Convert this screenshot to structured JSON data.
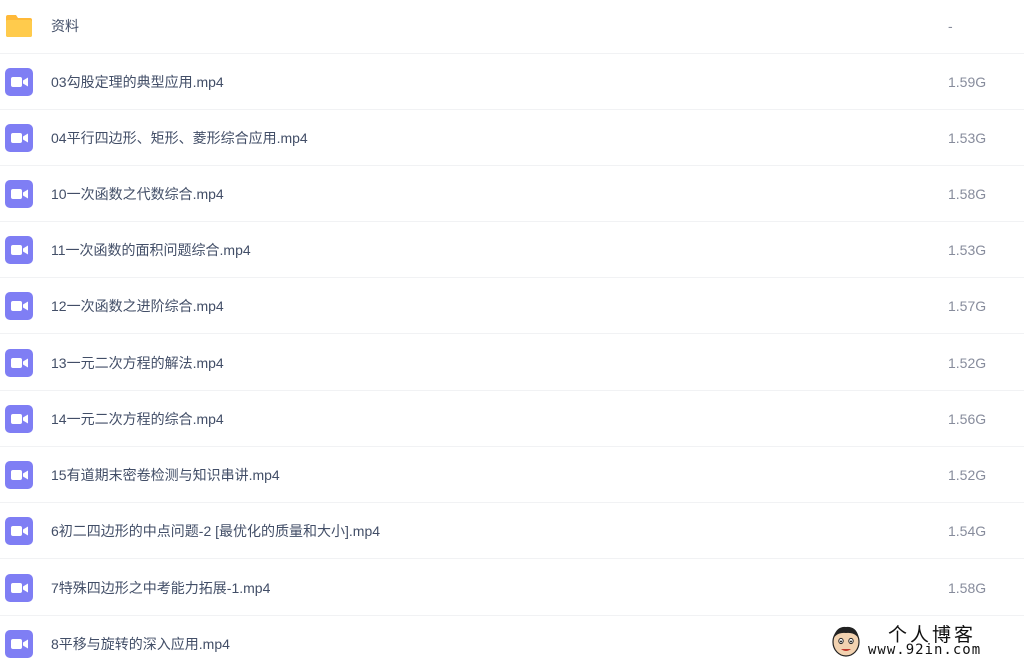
{
  "files": [
    {
      "name": "资料",
      "size": "-",
      "type": "folder",
      "icon": "folder-icon"
    },
    {
      "name": "03勾股定理的典型应用.mp4",
      "size": "1.59G",
      "type": "video",
      "icon": "video-file-icon"
    },
    {
      "name": "04平行四边形、矩形、菱形综合应用.mp4",
      "size": "1.53G",
      "type": "video",
      "icon": "video-file-icon"
    },
    {
      "name": "10一次函数之代数综合.mp4",
      "size": "1.58G",
      "type": "video",
      "icon": "video-file-icon"
    },
    {
      "name": "11一次函数的面积问题综合.mp4",
      "size": "1.53G",
      "type": "video",
      "icon": "video-file-icon"
    },
    {
      "name": "12一次函数之进阶综合.mp4",
      "size": "1.57G",
      "type": "video",
      "icon": "video-file-icon"
    },
    {
      "name": "13一元二次方程的解法.mp4",
      "size": "1.52G",
      "type": "video",
      "icon": "video-file-icon"
    },
    {
      "name": "14一元二次方程的综合.mp4",
      "size": "1.56G",
      "type": "video",
      "icon": "video-file-icon"
    },
    {
      "name": "15有道期末密卷检测与知识串讲.mp4",
      "size": "1.52G",
      "type": "video",
      "icon": "video-file-icon"
    },
    {
      "name": "6初二四边形的中点问题-2 [最优化的质量和大小].mp4",
      "size": "1.54G",
      "type": "video",
      "icon": "video-file-icon"
    },
    {
      "name": "7特殊四边形之中考能力拓展-1.mp4",
      "size": "1.58G",
      "type": "video",
      "icon": "video-file-icon"
    },
    {
      "name": "8平移与旋转的深入应用.mp4",
      "size": "",
      "type": "video",
      "icon": "video-file-icon"
    }
  ],
  "watermark": {
    "title": "个人博客",
    "url": "www.92in.com",
    "icon": "mascot-face-icon"
  },
  "colors": {
    "folder": "#ffcb4c",
    "folder_tab": "#ffb938",
    "video": "#7f7ef4",
    "text": "#424e67",
    "size_text": "#878c9c",
    "divider": "#f1f2f4"
  }
}
